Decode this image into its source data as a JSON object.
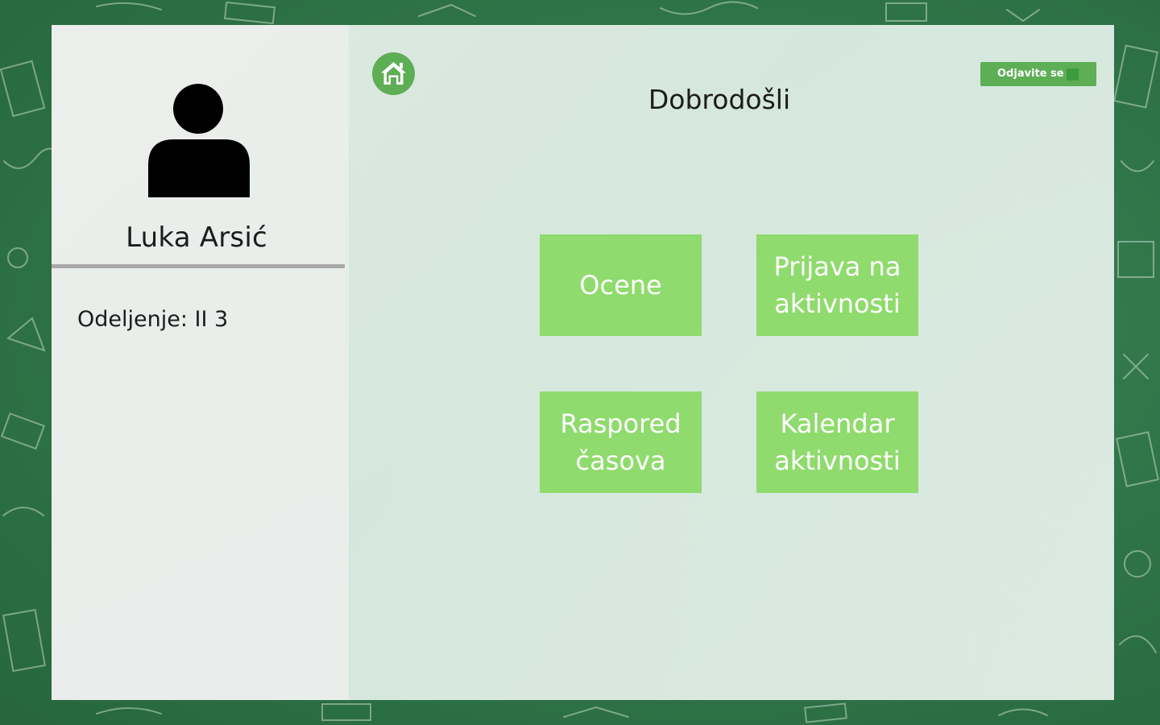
{
  "sidebar": {
    "user_name": "Luka Arsić",
    "class_label": "Odeljenje: II 3"
  },
  "header": {
    "title": "Dobrodošli",
    "logout_label": "Odjavite se"
  },
  "tiles": [
    {
      "label": "Ocene"
    },
    {
      "label": "Prijava na\naktivnosti"
    },
    {
      "label": "Raspored\nčasova"
    },
    {
      "label": "Kalendar\naktivnosti"
    }
  ],
  "colors": {
    "board": "#2f7448",
    "accent": "#5dae55",
    "tile": "#8fdb6d",
    "logout_square": "#3e9b3f"
  },
  "icons": {
    "home": "home-icon",
    "avatar": "user-avatar-icon"
  }
}
